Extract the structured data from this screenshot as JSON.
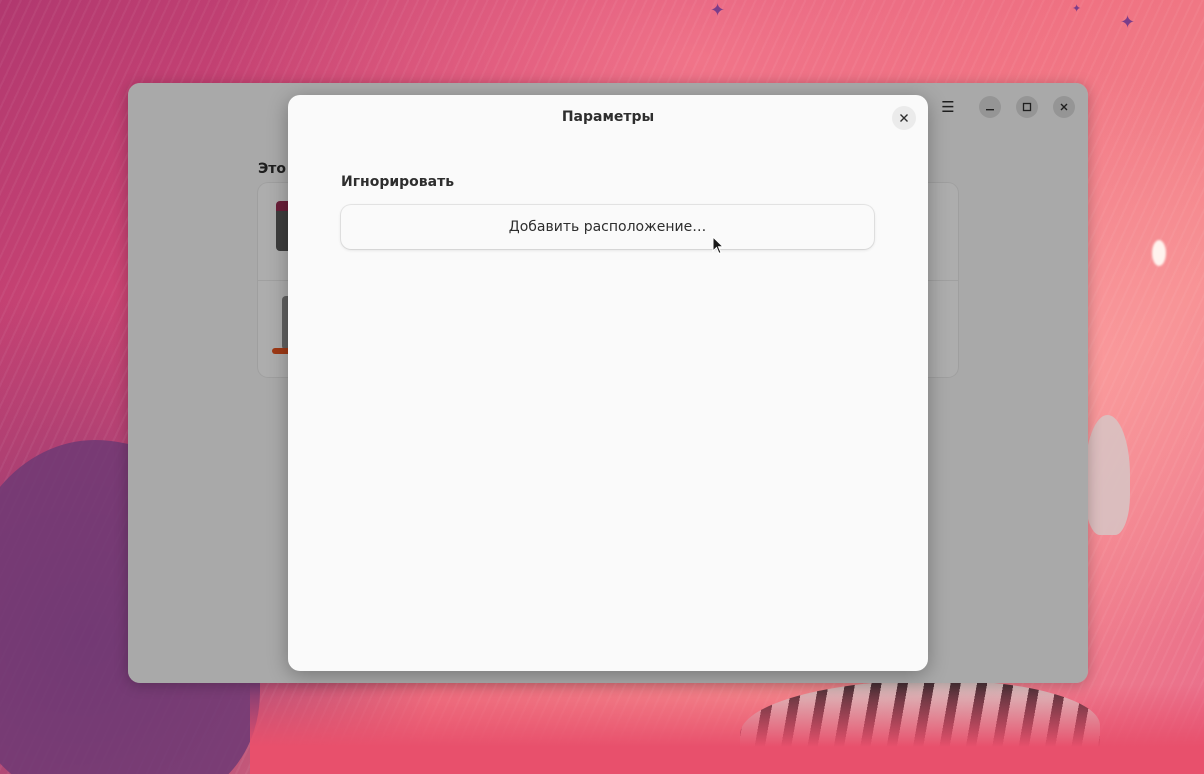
{
  "background_window": {
    "section_label": "Это у"
  },
  "dialog": {
    "title": "Параметры",
    "close_icon": "✕",
    "ignore_group": {
      "label": "Игнорировать",
      "add_location_label": "Добавить расположение…"
    }
  },
  "colors": {
    "accent": "#e95420",
    "dialog_bg": "#fafafa",
    "overlay": "rgba(0,0,0,0.32)"
  },
  "icons": {
    "menu": "hamburger-menu-icon",
    "minimize": "minimize-icon",
    "maximize": "maximize-icon",
    "close": "close-icon"
  }
}
